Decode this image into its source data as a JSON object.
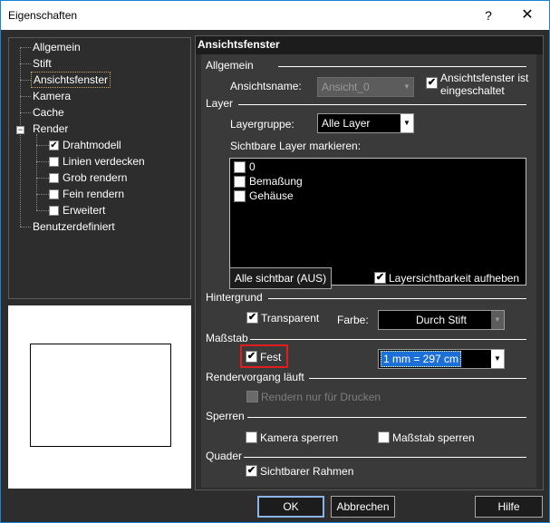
{
  "window": {
    "title": "Eigenschaften",
    "help_glyph": "?",
    "close_glyph": "✕"
  },
  "tree": {
    "items": [
      {
        "label": "Allgemein"
      },
      {
        "label": "Stift"
      },
      {
        "label": "Ansichtsfenster",
        "selected": true
      },
      {
        "label": "Kamera"
      },
      {
        "label": "Cache"
      },
      {
        "label": "Render",
        "expanded": true,
        "expander": "−"
      },
      {
        "label": "Drahtmodell",
        "checked": true
      },
      {
        "label": "Linien verdecken",
        "checked": false
      },
      {
        "label": "Grob rendern",
        "checked": false
      },
      {
        "label": "Fein rendern",
        "checked": false
      },
      {
        "label": "Erweitert",
        "checked": false
      },
      {
        "label": "Benutzerdefiniert"
      }
    ]
  },
  "panel": {
    "header": "Ansichtsfenster",
    "general": {
      "group": "Allgemein",
      "view_name_label": "Ansichtsname:",
      "view_name_value": "Ansicht_0",
      "enabled_label": "Ansichtsfenster ist eingeschaltet",
      "enabled_checked": true
    },
    "layer": {
      "group": "Layer",
      "layergroup_label": "Layergruppe:",
      "layergroup_value": "Alle Layer",
      "visible_label": "Sichtbare Layer markieren:",
      "layers": [
        {
          "name": "0",
          "checked": false
        },
        {
          "name": "Bemaßung",
          "checked": false
        },
        {
          "name": "Gehäuse",
          "checked": false
        }
      ],
      "all_visible_button": "Alle sichtbar (AUS)",
      "lift_visibility_label": "Layersichtbarkeit aufheben",
      "lift_visibility_checked": true
    },
    "background": {
      "group": "Hintergrund",
      "transparent_label": "Transparent",
      "transparent_checked": true,
      "color_label": "Farbe:",
      "color_value": "Durch Stift"
    },
    "scale": {
      "group": "Maßstab",
      "fixed_label": "Fest",
      "fixed_checked": true,
      "value": "1 mm = 297 cm"
    },
    "render": {
      "group": "Rendervorgang läuft",
      "print_only_label": "Rendern nur für Drucken",
      "print_only_checked": false
    },
    "lock": {
      "group": "Sperren",
      "camera_label": "Kamera sperren",
      "camera_checked": false,
      "scale_label": "Maßstab sperren",
      "scale_checked": false
    },
    "box": {
      "group": "Quader",
      "visible_frame_label": "Sichtbarer Rahmen",
      "visible_frame_checked": true
    }
  },
  "footer": {
    "ok": "OK",
    "cancel": "Abbrechen",
    "help": "Hilfe"
  },
  "colors": {
    "background": "#2d2d2d",
    "panel": "#3a3a3a",
    "selection": "#1c6fd6",
    "highlight_border": "#e11c1c"
  }
}
